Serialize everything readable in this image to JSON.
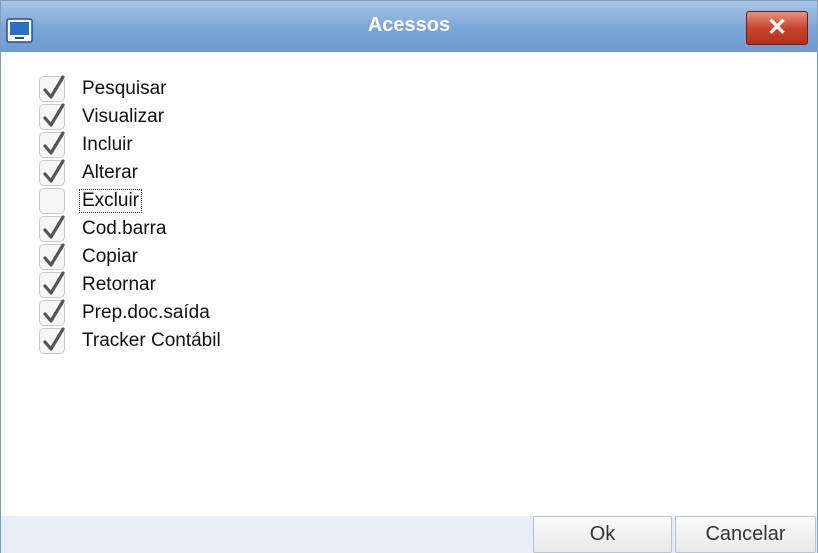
{
  "window": {
    "title": "Acessos"
  },
  "titlebar": {
    "close_label": "x"
  },
  "permissions": [
    {
      "label": "Pesquisar",
      "checked": true
    },
    {
      "label": "Visualizar",
      "checked": true
    },
    {
      "label": "Incluir",
      "checked": true
    },
    {
      "label": "Alterar",
      "checked": true
    },
    {
      "label": "Excluir",
      "checked": false,
      "focused": true
    },
    {
      "label": "Cod.barra",
      "checked": true
    },
    {
      "label": "Copiar",
      "checked": true
    },
    {
      "label": "Retornar",
      "checked": true
    },
    {
      "label": "Prep.doc.saída",
      "checked": true
    },
    {
      "label": "Tracker Contábil",
      "checked": true
    }
  ],
  "footer": {
    "ok_label": "Ok",
    "cancel_label": "Cancelar"
  },
  "colors": {
    "titlebar": "#7aa4d6",
    "close_button": "#c8452c",
    "footer": "#e7eef8",
    "check": "#555555"
  }
}
